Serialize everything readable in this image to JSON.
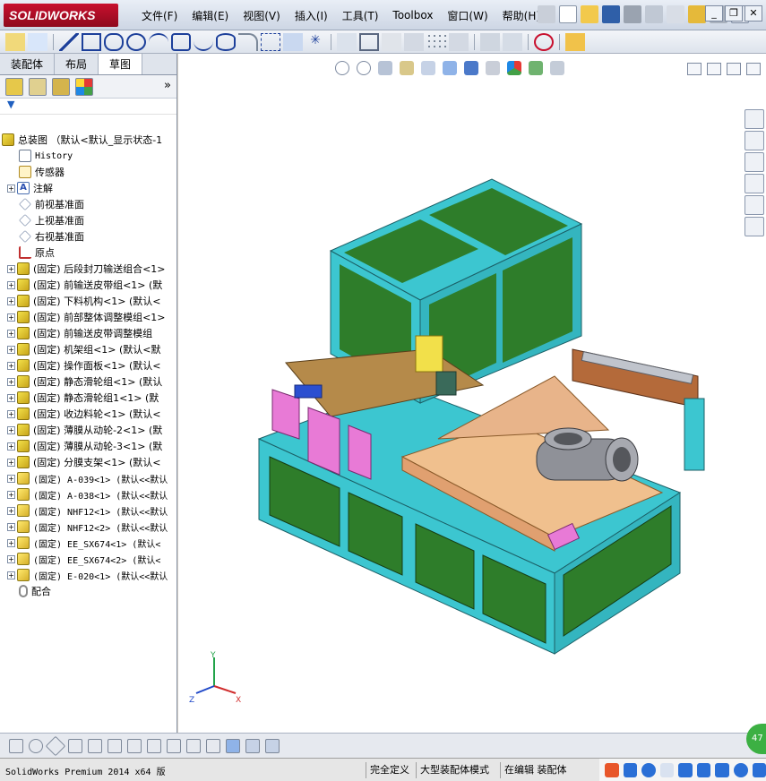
{
  "app": {
    "logo": "SOLIDWORKS",
    "menu": [
      "文件(F)",
      "编辑(E)",
      "视图(V)",
      "插入(I)",
      "工具(T)",
      "Toolbox",
      "窗口(W)",
      "帮助(H)"
    ]
  },
  "tabs": [
    "装配体",
    "布局",
    "草图"
  ],
  "active_tab": "草图",
  "feature_tree": {
    "root": "总装图 （默认<默认_显示状态-1",
    "items": [
      {
        "label": "History",
        "icon": "history-icon",
        "expand": false,
        "mono": true
      },
      {
        "label": "传感器",
        "icon": "sensor-icon",
        "expand": false
      },
      {
        "label": "注解",
        "icon": "annotation-icon",
        "expand": true
      },
      {
        "label": "前视基准面",
        "icon": "plane-icon",
        "expand": false
      },
      {
        "label": "上视基准面",
        "icon": "plane-icon",
        "expand": false
      },
      {
        "label": "右视基准面",
        "icon": "plane-icon",
        "expand": false
      },
      {
        "label": "原点",
        "icon": "origin-icon",
        "expand": false
      },
      {
        "label": "(固定) 后段封刀输送组合<1>",
        "icon": "assembly-icon",
        "expand": true
      },
      {
        "label": "(固定) 前输送皮带组<1> (默",
        "icon": "assembly-icon",
        "expand": true
      },
      {
        "label": "(固定) 下料机构<1> (默认<",
        "icon": "assembly-icon",
        "expand": true
      },
      {
        "label": "(固定) 前部整体调整模组<1>",
        "icon": "assembly-icon",
        "expand": true
      },
      {
        "label": "(固定) 前输送皮带调整模组",
        "icon": "assembly-icon",
        "expand": true
      },
      {
        "label": "(固定) 机架组<1> (默认<默",
        "icon": "assembly-icon",
        "expand": true
      },
      {
        "label": "(固定) 操作面板<1> (默认<",
        "icon": "assembly-icon",
        "expand": true
      },
      {
        "label": "(固定) 静态滑轮组<1> (默认",
        "icon": "assembly-icon",
        "expand": true
      },
      {
        "label": "(固定) 静态滑轮组1<1> (默",
        "icon": "assembly-icon",
        "expand": true
      },
      {
        "label": "(固定) 收边料轮<1> (默认<",
        "icon": "assembly-icon",
        "expand": true
      },
      {
        "label": "(固定) 薄膜从动轮-2<1> (默",
        "icon": "assembly-icon",
        "expand": true
      },
      {
        "label": "(固定) 薄膜从动轮-3<1> (默",
        "icon": "assembly-icon",
        "expand": true
      },
      {
        "label": "(固定) 分膜支架<1> (默认<",
        "icon": "assembly-icon",
        "expand": true
      },
      {
        "label": "(固定) A-039<1> (默认<<默认",
        "icon": "part-icon",
        "expand": true
      },
      {
        "label": "(固定) A-038<1> (默认<<默认",
        "icon": "part-icon",
        "expand": true
      },
      {
        "label": "(固定) NHF12<1> (默认<<默认",
        "icon": "part-icon",
        "expand": true
      },
      {
        "label": "(固定) NHF12<2> (默认<<默认",
        "icon": "part-icon",
        "expand": true
      },
      {
        "label": "(固定) EE_SX674<1> (默认<",
        "icon": "part-icon",
        "expand": true
      },
      {
        "label": "(固定) EE_SX674<2> (默认<",
        "icon": "part-icon",
        "expand": true
      },
      {
        "label": "(固定) E-020<1> (默认<<默认",
        "icon": "part-icon",
        "expand": true
      },
      {
        "label": "配合",
        "icon": "mates-icon",
        "expand": false
      }
    ]
  },
  "triad": {
    "y": "Y",
    "x": "X",
    "z": "Z"
  },
  "status": {
    "product": "SolidWorks Premium 2014 x64 版",
    "state1": "完全定义",
    "state2": "大型装配体模式",
    "state3": "在编辑 装配体"
  },
  "badge": "47",
  "colors": {
    "frame": "#3cc6d0",
    "panel": "#2e7d2a",
    "accent": "#c8102e"
  }
}
